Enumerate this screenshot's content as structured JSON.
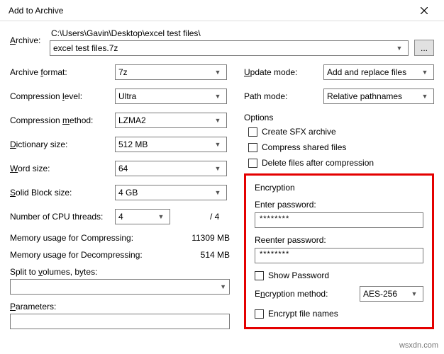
{
  "title": "Add to Archive",
  "archive": {
    "label": "Archive:",
    "path": "C:\\Users\\Gavin\\Desktop\\excel test files\\",
    "filename": "excel test files.7z",
    "browse_label": "..."
  },
  "left": {
    "format": {
      "label": "Archive format:",
      "value": "7z"
    },
    "level": {
      "label": "Compression level:",
      "value": "Ultra"
    },
    "method": {
      "label": "Compression method:",
      "value": "LZMA2"
    },
    "dict": {
      "label": "Dictionary size:",
      "value": "512 MB"
    },
    "word": {
      "label": "Word size:",
      "value": "64"
    },
    "block": {
      "label": "Solid Block size:",
      "value": "4 GB"
    },
    "threads": {
      "label": "Number of CPU threads:",
      "value": "4",
      "max": "/ 4"
    },
    "mem_compress": {
      "label": "Memory usage for Compressing:",
      "value": "11309 MB"
    },
    "mem_decompress": {
      "label": "Memory usage for Decompressing:",
      "value": "514 MB"
    },
    "split": {
      "label": "Split to volumes, bytes:",
      "value": ""
    },
    "params": {
      "label": "Parameters:",
      "value": ""
    }
  },
  "right": {
    "update": {
      "label": "Update mode:",
      "value": "Add and replace files"
    },
    "path": {
      "label": "Path mode:",
      "value": "Relative pathnames"
    },
    "options_label": "Options",
    "opt_sfx": "Create SFX archive",
    "opt_shared": "Compress shared files",
    "opt_delete": "Delete files after compression"
  },
  "enc": {
    "title": "Encryption",
    "enter_label": "Enter password:",
    "reenter_label": "Reenter password:",
    "pw_value": "********",
    "show_pw": "Show Password",
    "method_label": "Encryption method:",
    "method_value": "AES-256",
    "encrypt_names": "Encrypt file names"
  },
  "watermark": "wsxdn.com"
}
